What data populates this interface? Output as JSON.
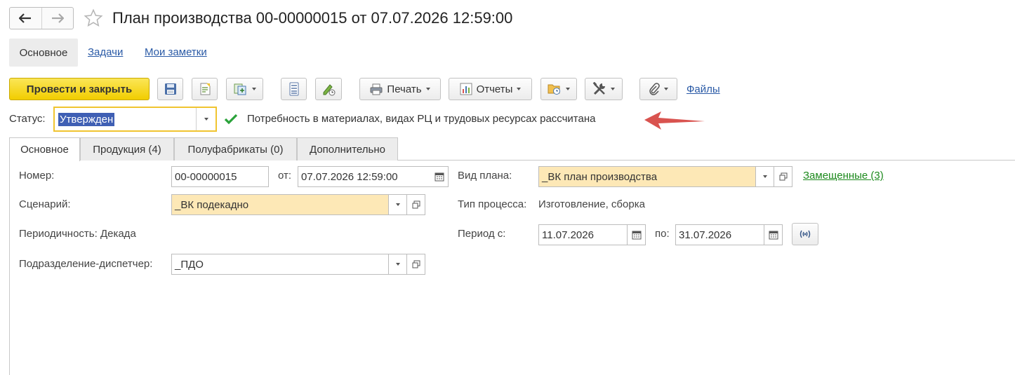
{
  "header": {
    "title": "План производства 00-00000015 от 07.07.2026 12:59:00"
  },
  "form_nav": {
    "active": "Основное",
    "links": [
      "Задачи",
      "Мои заметки"
    ]
  },
  "toolbar": {
    "post_close": "Провести и закрыть",
    "print": "Печать",
    "reports": "Отчеты",
    "files": "Файлы"
  },
  "status": {
    "label": "Статус:",
    "value": "Утвержден",
    "message": "Потребность в материалах, видах РЦ и трудовых ресурсах рассчитана"
  },
  "tabs": [
    "Основное",
    "Продукция (4)",
    "Полуфабрикаты (0)",
    "Дополнительно"
  ],
  "fields": {
    "number_label": "Номер:",
    "number_value": "00-00000015",
    "from_label": "от:",
    "from_value": "07.07.2026 12:59:00",
    "plan_type_label": "Вид плана:",
    "plan_type_value": "_ВК план производства",
    "replaced_link": "Замещенные (3)",
    "scenario_label": "Сценарий:",
    "scenario_value": "_ВК подекадно",
    "process_type_label": "Тип процесса:",
    "process_type_value": "Изготовление, сборка",
    "periodicity": "Периодичность: Декада",
    "period_from_label": "Период с:",
    "period_from_value": "11.07.2026",
    "period_to_label": "по:",
    "period_to_value": "31.07.2026",
    "dispatcher_label": "Подразделение-диспетчер:",
    "dispatcher_value": "_ПДО"
  },
  "colors": {
    "primary_button": "#f1cd00",
    "required_field": "#fde8b6",
    "link": "#2a5aa6",
    "success_check": "#2aa23a",
    "annotation_arrow": "#d9534f"
  }
}
